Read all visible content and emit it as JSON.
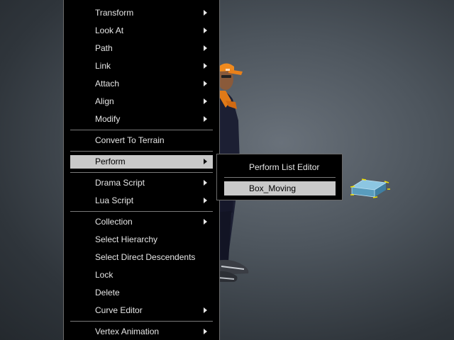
{
  "context_menu": {
    "items": [
      {
        "label": "Transform",
        "submenu": true
      },
      {
        "label": "Look At",
        "submenu": true
      },
      {
        "label": "Path",
        "submenu": true
      },
      {
        "label": "Link",
        "submenu": true
      },
      {
        "label": "Attach",
        "submenu": true
      },
      {
        "label": "Align",
        "submenu": true
      },
      {
        "label": "Modify",
        "submenu": true
      },
      {
        "label": "Convert To Terrain",
        "submenu": false
      },
      {
        "label": "Perform",
        "submenu": true,
        "highlighted": true
      },
      {
        "label": "Drama Script",
        "submenu": true
      },
      {
        "label": "Lua Script",
        "submenu": true
      },
      {
        "label": "Collection",
        "submenu": true
      },
      {
        "label": "Select Hierarchy",
        "submenu": false
      },
      {
        "label": "Select Direct Descendents",
        "submenu": false
      },
      {
        "label": "Lock",
        "submenu": false
      },
      {
        "label": "Delete",
        "submenu": false
      },
      {
        "label": "Curve Editor",
        "submenu": true
      },
      {
        "label": "Vertex Animation",
        "submenu": true
      }
    ]
  },
  "perform_submenu": {
    "items": [
      {
        "label": "Perform List Editor"
      },
      {
        "label": "Box_Moving",
        "highlighted": true
      }
    ]
  },
  "colors": {
    "menu_bg": "#000000",
    "menu_text": "#e6e6e6",
    "highlight_bg": "#c9c9c9",
    "viewport_bg": "#4d555d",
    "selection_handles": "#f2e200"
  }
}
